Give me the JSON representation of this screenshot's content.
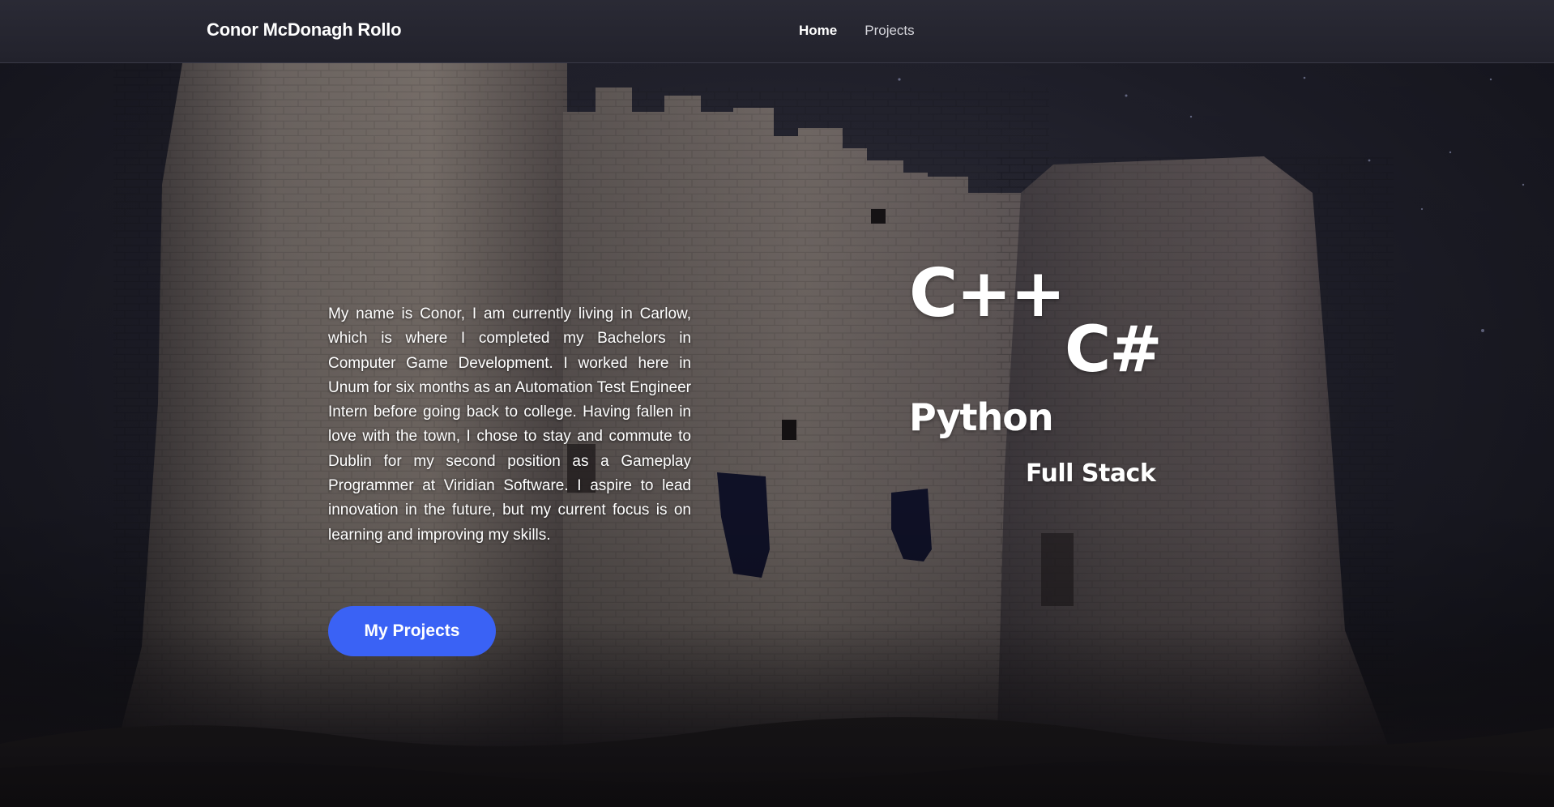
{
  "nav": {
    "brand": "Conor McDonagh Rollo",
    "links": [
      {
        "label": "Home",
        "active": true
      },
      {
        "label": "Projects",
        "active": false
      }
    ]
  },
  "hero": {
    "about_text": "My name is Conor, I am currently living in Carlow, which is where I completed my Bachelors in Computer Game Development. I worked here in Unum for six months as an Automation Test Engineer Intern before going back to college. Having fallen in love with the town, I chose to stay and commute to Dublin for my second position as a Gameplay Programmer at Viridian Software. I aspire to lead innovation in the future, but my current focus is on learning and improving my skills.",
    "cta_label": "My Projects",
    "skills": [
      "C++",
      "C#",
      "Python",
      "Full Stack"
    ]
  },
  "colors": {
    "nav_bg": "#26262f",
    "cta_bg": "#3a62f5",
    "text": "#ffffff"
  }
}
